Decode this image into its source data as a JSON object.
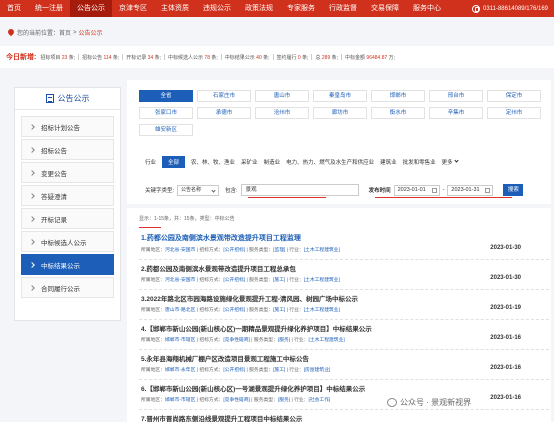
{
  "nav": {
    "items": [
      "首页",
      "统一注册",
      "公告公示",
      "京津专区",
      "主体资质",
      "违规公示",
      "政策法规",
      "专家服务",
      "行政监督",
      "交易保障",
      "服务中心"
    ],
    "active_index": 2,
    "phone": "0311-88614089/176/169"
  },
  "breadcrumb": {
    "prefix": "您的当前位置：",
    "home": "首页",
    "sep": ">",
    "current": "公告公示"
  },
  "stats": {
    "label": "今日新增:",
    "items": [
      {
        "name": "招标项目",
        "value": "23",
        "unit": "条;"
      },
      {
        "name": "招标公告",
        "value": "114",
        "unit": "条;"
      },
      {
        "name": "开标记录",
        "value": "34",
        "unit": "条;"
      },
      {
        "name": "中标候选人公示",
        "value": "78",
        "unit": "条;"
      },
      {
        "name": "中标结果公示",
        "value": "40",
        "unit": "条;"
      },
      {
        "name": "签约履行",
        "value": "0",
        "unit": "条;"
      },
      {
        "name": "总",
        "value": "289",
        "unit": "条;"
      },
      {
        "name": "中标金额",
        "value": "96484.87",
        "unit": "万;"
      }
    ]
  },
  "sidebar": {
    "title": "公告公示",
    "items": [
      "招标计划公告",
      "招标公告",
      "变更公告",
      "答疑澄清",
      "开标记录",
      "中标候选人公示",
      "中标结果公示",
      "合同履行公示"
    ],
    "active_index": 6
  },
  "cities": [
    "全省",
    "石家庄市",
    "唐山市",
    "秦皇岛市",
    "邯郸市",
    "邢台市",
    "保定市",
    "张家口市",
    "承德市",
    "沧州市",
    "廊坊市",
    "衡水市",
    "辛集市",
    "定州市",
    "雄安新区"
  ],
  "industry": {
    "label": "行业",
    "options": [
      "全部",
      "农、林、牧、渔业",
      "采矿业",
      "制造业",
      "电力、热力、燃气及水生产和供应业",
      "建筑业",
      "批发和零售业",
      "更多"
    ],
    "active_index": 0
  },
  "filter": {
    "keyword_type_label": "关键字类型:",
    "keyword_type_value": "公告名称",
    "contains_label": "包含:",
    "keyword": "景观",
    "publish_time_label": "发布时间",
    "date_from": "2023-01-01",
    "date_to": "2023-01-31",
    "search_label": "搜索"
  },
  "results": {
    "summary": "显示：1-15条，共：15条，类型：中标公告"
  },
  "list": [
    {
      "title": "1.药都公园及南侧滨水景观带改造提升项目工程监理",
      "region": "河北省-安国市",
      "method": "[公开招标]",
      "service": "[监理]",
      "industry": "[土木工程建筑业]",
      "date": "2023-01-30"
    },
    {
      "title": "2.药都公园及南侧滨水景观带改造提升项目工程总承包",
      "region": "河北省-安国市",
      "method": "[公开招标]",
      "service": "[施工]",
      "industry": "[土木工程建筑业]",
      "date": "2023-01-30"
    },
    {
      "title": "3.2022年路北区市园海路设施绿化景观提升工程-清风园、树园广场中标公示",
      "region": "唐山市-路北区",
      "method": "[公开招标]",
      "service": "[施工]",
      "industry": "[土木工程建筑业]",
      "date": "2023-01-19"
    },
    {
      "title": "4.【邯郸市新山公园(新山核心区)一期精品景观提升绿化养护项目】中标结果公示",
      "region": "邯郸市-市辖区",
      "method": "[竞争性磋商]",
      "service": "[服务]",
      "industry": "[土木工程建筑业]",
      "date": "2023-01-16"
    },
    {
      "title": "5.永年县海翔机械厂棚户区改造项目景观工程施工中标公告",
      "region": "邯郸市-永年区",
      "method": "[公开招标]",
      "service": "[施工]",
      "industry": "[房屋建筑业]",
      "date": "2023-01-16"
    },
    {
      "title": "6.【邯郸市新山公园(新山核心区)一号湖景观提升绿化养护项目】中标结果公示",
      "region": "邯郸市-市辖区",
      "method": "[竞争性磋商]",
      "service": "[服务]",
      "industry": "[社会工作]",
      "date": "2023-01-16"
    },
    {
      "title": "7.晋州市晋尚路东侧沿线景观提升工程项目中标结果公示",
      "region": "",
      "method": "",
      "service": "",
      "industry": "",
      "date": ""
    }
  ],
  "meta_labels": {
    "region": "所属地区：",
    "method": "招标方式：",
    "service": "服务类型：",
    "industry": "行业："
  },
  "watermark": "公众号 · 景观新视界",
  "colors": {
    "nav_red": "#d0311c",
    "accent_blue": "#1d5fb8",
    "annotation_red": "#e0302c"
  }
}
